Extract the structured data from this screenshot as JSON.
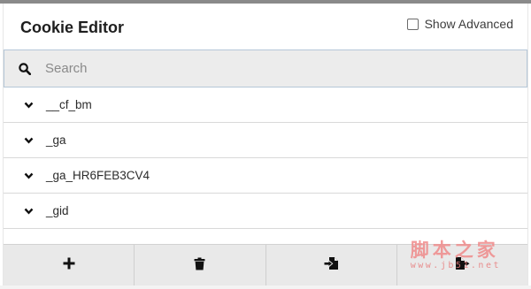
{
  "header": {
    "title": "Cookie Editor",
    "show_advanced_label": "Show Advanced",
    "show_advanced_checked": false
  },
  "search": {
    "placeholder": "Search",
    "value": "",
    "icon": "search-icon"
  },
  "cookies": [
    {
      "name": "__cf_bm",
      "icon": "chevron-down-icon"
    },
    {
      "name": "_ga",
      "icon": "chevron-down-icon"
    },
    {
      "name": "_ga_HR6FEB3CV4",
      "icon": "chevron-down-icon"
    },
    {
      "name": "_gid",
      "icon": "chevron-down-icon"
    }
  ],
  "toolbar": {
    "buttons": [
      {
        "icon": "plus-icon"
      },
      {
        "icon": "trash-icon"
      },
      {
        "icon": "import-icon"
      },
      {
        "icon": "export-icon"
      }
    ]
  },
  "watermark": {
    "text": "脚本之家",
    "url": "www.jb51.net"
  },
  "colors": {
    "search_bg": "#ececec",
    "search_border": "#b5c7d8",
    "toolbar_bg": "#e9e9e9",
    "watermark": "#f08a8a"
  }
}
